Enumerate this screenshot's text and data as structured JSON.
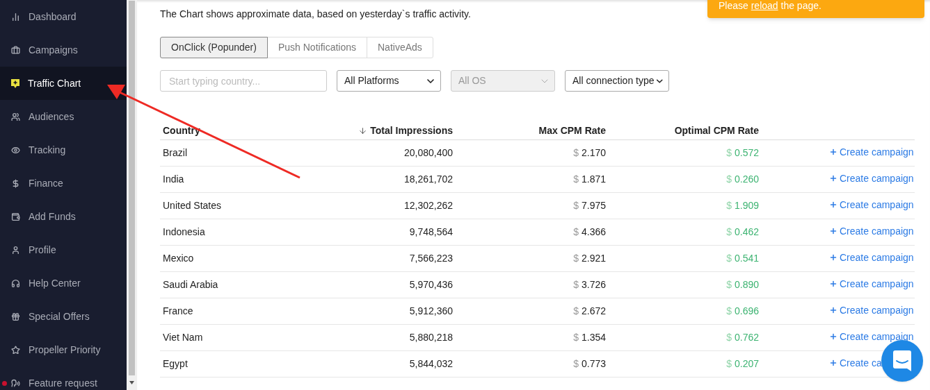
{
  "sidebar": {
    "items": [
      {
        "label": "Dashboard",
        "selected": false
      },
      {
        "label": "Campaigns",
        "selected": false
      },
      {
        "label": "Traffic Chart",
        "selected": true
      },
      {
        "label": "Audiences",
        "selected": false
      },
      {
        "label": "Tracking",
        "selected": false
      },
      {
        "label": "Finance",
        "selected": false
      },
      {
        "label": "Add Funds",
        "selected": false
      },
      {
        "label": "Profile",
        "selected": false
      },
      {
        "label": "Help Center",
        "selected": false
      },
      {
        "label": "Special Offers",
        "selected": false
      },
      {
        "label": "Propeller Priority",
        "selected": false
      },
      {
        "label": "Feature request",
        "selected": false,
        "notification": true
      }
    ]
  },
  "notice": "The Chart shows approximate data, based on yesterday`s traffic activity.",
  "toast": {
    "before": "Please",
    "link": "reload",
    "after": "the page."
  },
  "tabs": [
    {
      "label": "OnClick (Popunder)",
      "selected": true
    },
    {
      "label": "Push Notifications",
      "selected": false
    },
    {
      "label": "NativeAds",
      "selected": false
    }
  ],
  "filters": {
    "search": {
      "placeholder": "Start typing country..."
    },
    "selects": [
      {
        "value": "All Platforms",
        "disabled": false
      },
      {
        "value": "All OS",
        "disabled": true
      },
      {
        "value": "All connection type",
        "disabled": false
      }
    ]
  },
  "table": {
    "columns": [
      "Country",
      "Total Impressions",
      "Max CPM Rate",
      "Optimal CPM Rate"
    ],
    "rows": [
      {
        "country": "Brazil",
        "impressions": "20,080,400",
        "max_cpm": "2.170",
        "optimal_cpm": "0.572",
        "action": "Create campaign"
      },
      {
        "country": "India",
        "impressions": "18,261,702",
        "max_cpm": "1.871",
        "optimal_cpm": "0.260",
        "action": "Create campaign"
      },
      {
        "country": "United States",
        "impressions": "12,302,262",
        "max_cpm": "7.975",
        "optimal_cpm": "1.909",
        "action": "Create campaign"
      },
      {
        "country": "Indonesia",
        "impressions": "9,748,564",
        "max_cpm": "4.366",
        "optimal_cpm": "0.462",
        "action": "Create campaign"
      },
      {
        "country": "Mexico",
        "impressions": "7,566,223",
        "max_cpm": "2.921",
        "optimal_cpm": "0.541",
        "action": "Create campaign"
      },
      {
        "country": "Saudi Arabia",
        "impressions": "5,970,436",
        "max_cpm": "3.726",
        "optimal_cpm": "0.890",
        "action": "Create campaign"
      },
      {
        "country": "France",
        "impressions": "5,912,360",
        "max_cpm": "2.672",
        "optimal_cpm": "0.696",
        "action": "Create campaign"
      },
      {
        "country": "Viet Nam",
        "impressions": "5,880,218",
        "max_cpm": "1.354",
        "optimal_cpm": "0.762",
        "action": "Create campaign"
      },
      {
        "country": "Egypt",
        "impressions": "5,844,032",
        "max_cpm": "0.773",
        "optimal_cpm": "0.207",
        "action": "Create ca"
      }
    ],
    "currency": "$"
  }
}
